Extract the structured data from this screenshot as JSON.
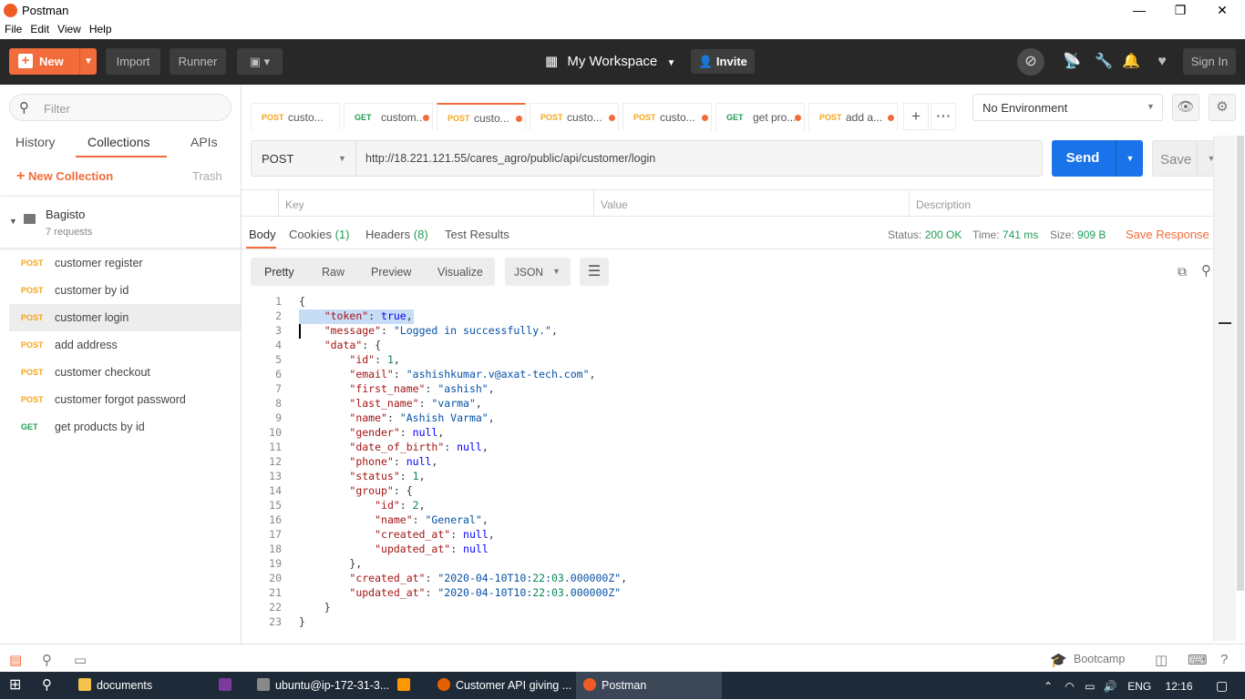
{
  "window": {
    "title": "Postman",
    "min": "—",
    "max": "❐",
    "close": "✕"
  },
  "menu": [
    "File",
    "Edit",
    "View",
    "Help"
  ],
  "header": {
    "new_label": "New",
    "import_label": "Import",
    "runner_label": "Runner",
    "workspace": "My Workspace",
    "invite": "Invite",
    "signin": "Sign In"
  },
  "sidebar": {
    "filter_placeholder": "Filter",
    "tabs": [
      "History",
      "Collections",
      "APIs"
    ],
    "new_collection": "New Collection",
    "trash": "Trash",
    "collection": {
      "name": "Bagisto",
      "count": "7 requests"
    },
    "requests": [
      {
        "method": "POST",
        "name": "customer register"
      },
      {
        "method": "POST",
        "name": "customer by id"
      },
      {
        "method": "POST",
        "name": "customer login"
      },
      {
        "method": "POST",
        "name": "add address"
      },
      {
        "method": "POST",
        "name": "customer checkout"
      },
      {
        "method": "POST",
        "name": "customer forgot password"
      },
      {
        "method": "GET",
        "name": "get products by id"
      }
    ]
  },
  "tabs": [
    {
      "method": "POST",
      "name": "custo..."
    },
    {
      "method": "GET",
      "name": "custom..."
    },
    {
      "method": "POST",
      "name": "custo..."
    },
    {
      "method": "POST",
      "name": "custo..."
    },
    {
      "method": "POST",
      "name": "custo..."
    },
    {
      "method": "GET",
      "name": "get pro..."
    },
    {
      "method": "POST",
      "name": "add a..."
    }
  ],
  "environment": "No Environment",
  "request": {
    "method": "POST",
    "url": "http://18.221.121.55/cares_agro/public/api/customer/login",
    "send": "Send",
    "save": "Save"
  },
  "params": {
    "key": "Key",
    "value": "Value",
    "description": "Description"
  },
  "response": {
    "tabs": {
      "body": "Body",
      "cookies": "Cookies",
      "cookies_count": "(1)",
      "headers": "Headers",
      "headers_count": "(8)",
      "tests": "Test Results"
    },
    "status_label": "Status:",
    "status": "200 OK",
    "time_label": "Time:",
    "time": "741 ms",
    "size_label": "Size:",
    "size": "909 B",
    "save_response": "Save Response",
    "views": [
      "Pretty",
      "Raw",
      "Preview",
      "Visualize"
    ],
    "format": "JSON"
  },
  "code_lines": [
    "{",
    "    \"token\": true,",
    "    \"message\": \"Logged in successfully.\",",
    "    \"data\": {",
    "        \"id\": 1,",
    "        \"email\": \"ashishkumar.v@axat-tech.com\",",
    "        \"first_name\": \"ashish\",",
    "        \"last_name\": \"varma\",",
    "        \"name\": \"Ashish Varma\",",
    "        \"gender\": null,",
    "        \"date_of_birth\": null,",
    "        \"phone\": null,",
    "        \"status\": 1,",
    "        \"group\": {",
    "            \"id\": 2,",
    "            \"name\": \"General\",",
    "            \"created_at\": null,",
    "            \"updated_at\": null",
    "        },",
    "        \"created_at\": \"2020-04-10T10:22:03.000000Z\",",
    "        \"updated_at\": \"2020-04-10T10:22:03.000000Z\"",
    "    }",
    "}"
  ],
  "statusbar": {
    "bootcamp": "Bootcamp"
  },
  "taskbar": {
    "items": [
      "documents",
      "ubuntu@ip-172-31-3...",
      "Customer API giving ...",
      "Postman"
    ],
    "lang": "ENG",
    "time": "12:16"
  },
  "colors": {
    "accent": "#f26b3a",
    "send": "#1a73e8",
    "post": "#f4a51c",
    "get": "#1f9d55"
  }
}
